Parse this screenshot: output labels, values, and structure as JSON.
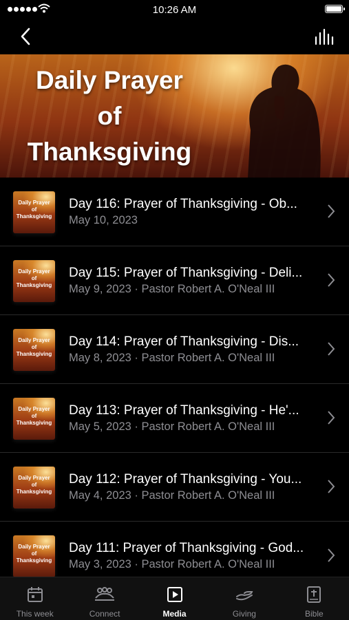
{
  "status_bar": {
    "time": "10:26 AM"
  },
  "banner": {
    "title_lines": [
      "Daily Prayer",
      "of",
      "Thanksgiving"
    ]
  },
  "thumbnail": {
    "text_lines": [
      "Daily Prayer",
      "of",
      "Thanksgiving"
    ]
  },
  "items": [
    {
      "title": "Day 116: Prayer of Thanksgiving - Ob...",
      "subtitle": "May 10, 2023"
    },
    {
      "title": "Day 115: Prayer of Thanksgiving - Deli...",
      "subtitle": "May 9, 2023 · Pastor Robert A. O'Neal III"
    },
    {
      "title": "Day 114: Prayer of Thanksgiving - Dis...",
      "subtitle": "May 8, 2023 · Pastor Robert A. O'Neal III"
    },
    {
      "title": "Day 113: Prayer of Thanksgiving - He'...",
      "subtitle": "May 5, 2023 · Pastor Robert A. O'Neal III"
    },
    {
      "title": "Day 112: Prayer of Thanksgiving - You...",
      "subtitle": "May 4, 2023 · Pastor Robert A. O'Neal III"
    },
    {
      "title": "Day 111: Prayer of Thanksgiving - God...",
      "subtitle": "May 3, 2023 · Pastor Robert A. O'Neal III"
    }
  ],
  "tabs": [
    {
      "label": "This week",
      "icon": "calendar-icon",
      "active": false
    },
    {
      "label": "Connect",
      "icon": "group-icon",
      "active": false
    },
    {
      "label": "Media",
      "icon": "play-icon",
      "active": true
    },
    {
      "label": "Giving",
      "icon": "giving-hand-icon",
      "active": false
    },
    {
      "label": "Bible",
      "icon": "bible-icon",
      "active": false
    }
  ],
  "colors": {
    "background": "#000000",
    "secondary_text": "#8e8e93",
    "active_tab": "#ffffff",
    "separator": "#2b2b2b"
  }
}
